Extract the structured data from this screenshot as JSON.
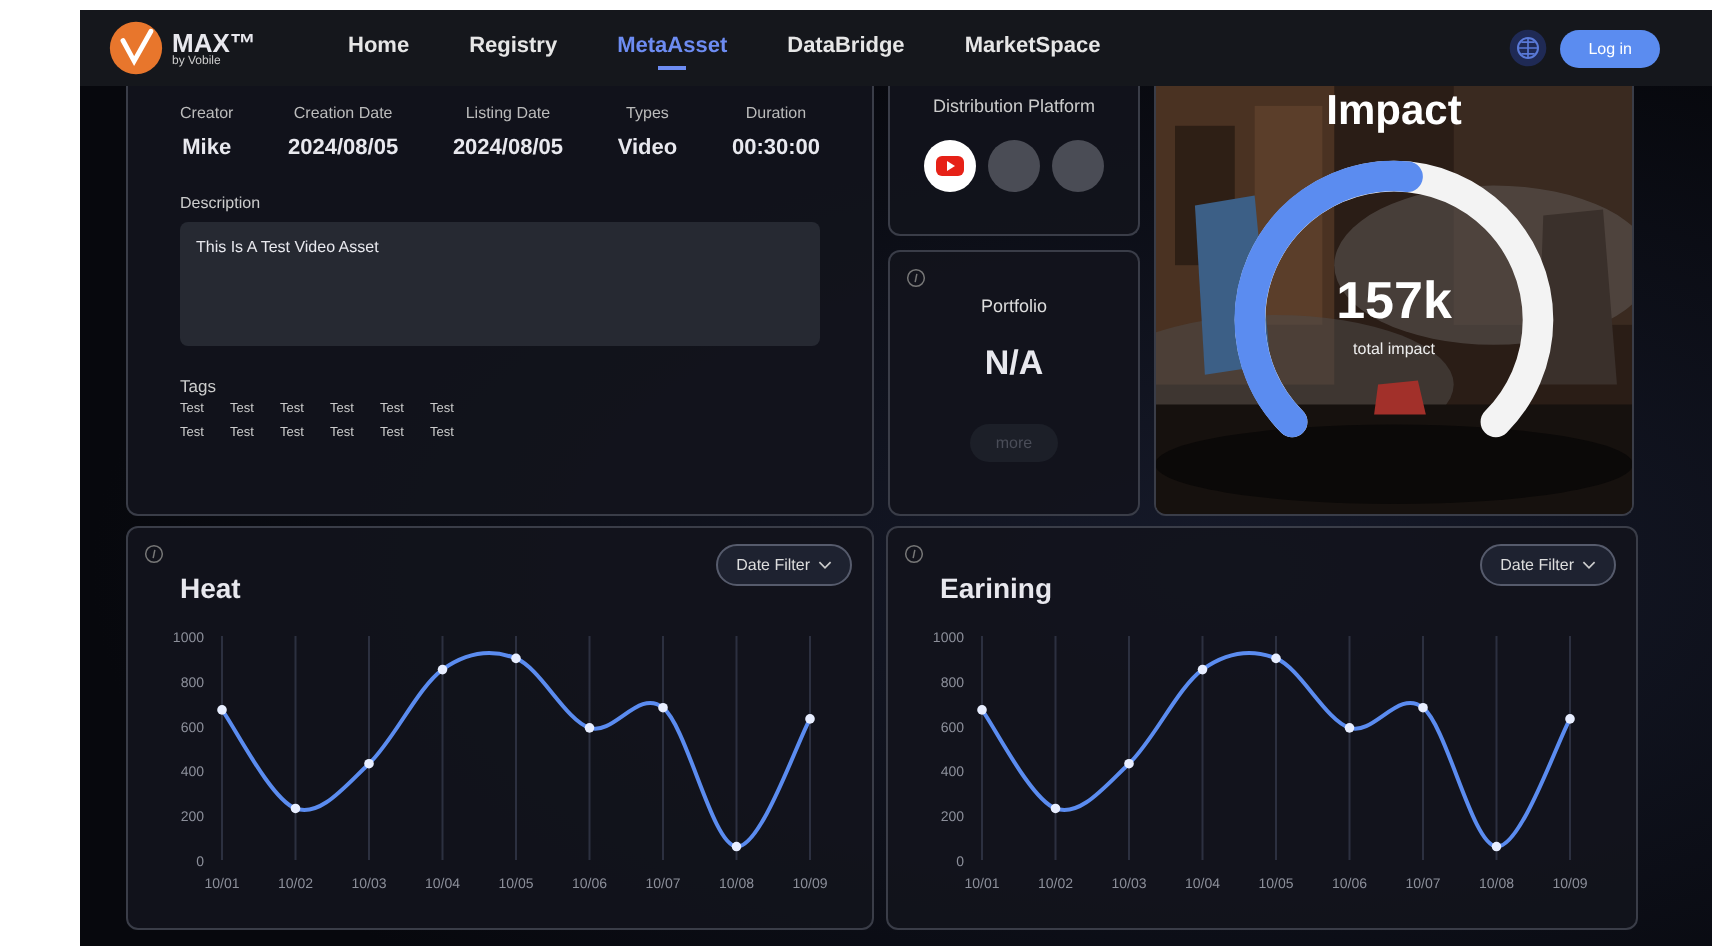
{
  "nav": {
    "logo": {
      "title": "MAX™",
      "subtitle": "by Vobile"
    },
    "items": [
      {
        "label": "Home",
        "selected": false
      },
      {
        "label": "Registry",
        "selected": false
      },
      {
        "label": "MetaAsset",
        "selected": true
      },
      {
        "label": "DataBridge",
        "selected": false
      },
      {
        "label": "MarketSpace",
        "selected": false
      }
    ],
    "login": "Log in"
  },
  "asset": {
    "fields": [
      {
        "label": "Creator",
        "value": "Mike"
      },
      {
        "label": "Creation Date",
        "value": "2024/08/05"
      },
      {
        "label": "Listing Date",
        "value": "2024/08/05"
      },
      {
        "label": "Types",
        "value": "Video"
      },
      {
        "label": "Duration",
        "value": "00:30:00"
      }
    ],
    "description_label": "Description",
    "description": "This Is A Test Video Asset",
    "tags_label": "Tags",
    "tags": [
      "Test",
      "Test",
      "Test",
      "Test",
      "Test",
      "Test",
      "Test",
      "Test",
      "Test",
      "Test",
      "Test",
      "Test"
    ]
  },
  "distribution": {
    "title": "Distribution Platform",
    "platforms": [
      {
        "kind": "youtube"
      },
      {
        "kind": "empty"
      },
      {
        "kind": "empty"
      }
    ]
  },
  "portfolio": {
    "title": "Portfolio",
    "value": "N/A",
    "button": {
      "label": "more",
      "disabled": true
    }
  },
  "impact": {
    "title": "Impact",
    "value": "157k",
    "caption": "total impact",
    "level": 0.52
  },
  "charts": [
    {
      "filter": "Date Filter",
      "chart_data": {
        "type": "line",
        "title": "Heat",
        "grid": true,
        "categories": [
          "10/01",
          "10/02",
          "10/03",
          "10/04",
          "10/05",
          "10/06",
          "10/07",
          "10/08",
          "10/09"
        ],
        "ylim": [
          0,
          1000
        ],
        "yticks": [
          0,
          200,
          400,
          600,
          800,
          1000
        ],
        "series": [
          {
            "color": "#5b8cf0",
            "marker": true,
            "values": [
              670,
              230,
              430,
              850,
              900,
              590,
              680,
              60,
              630
            ]
          }
        ]
      }
    },
    {
      "filter": "Date Filter",
      "chart_data": {
        "type": "line",
        "title": "Earining",
        "grid": true,
        "categories": [
          "10/01",
          "10/02",
          "10/03",
          "10/04",
          "10/05",
          "10/06",
          "10/07",
          "10/08",
          "10/09"
        ],
        "ylim": [
          0,
          1000
        ],
        "yticks": [
          0,
          200,
          400,
          600,
          800,
          1000
        ],
        "series": [
          {
            "color": "#5b8cf0",
            "marker": true,
            "values": [
              670,
              230,
              430,
              850,
              900,
              590,
              680,
              60,
              630
            ]
          }
        ]
      }
    }
  ]
}
